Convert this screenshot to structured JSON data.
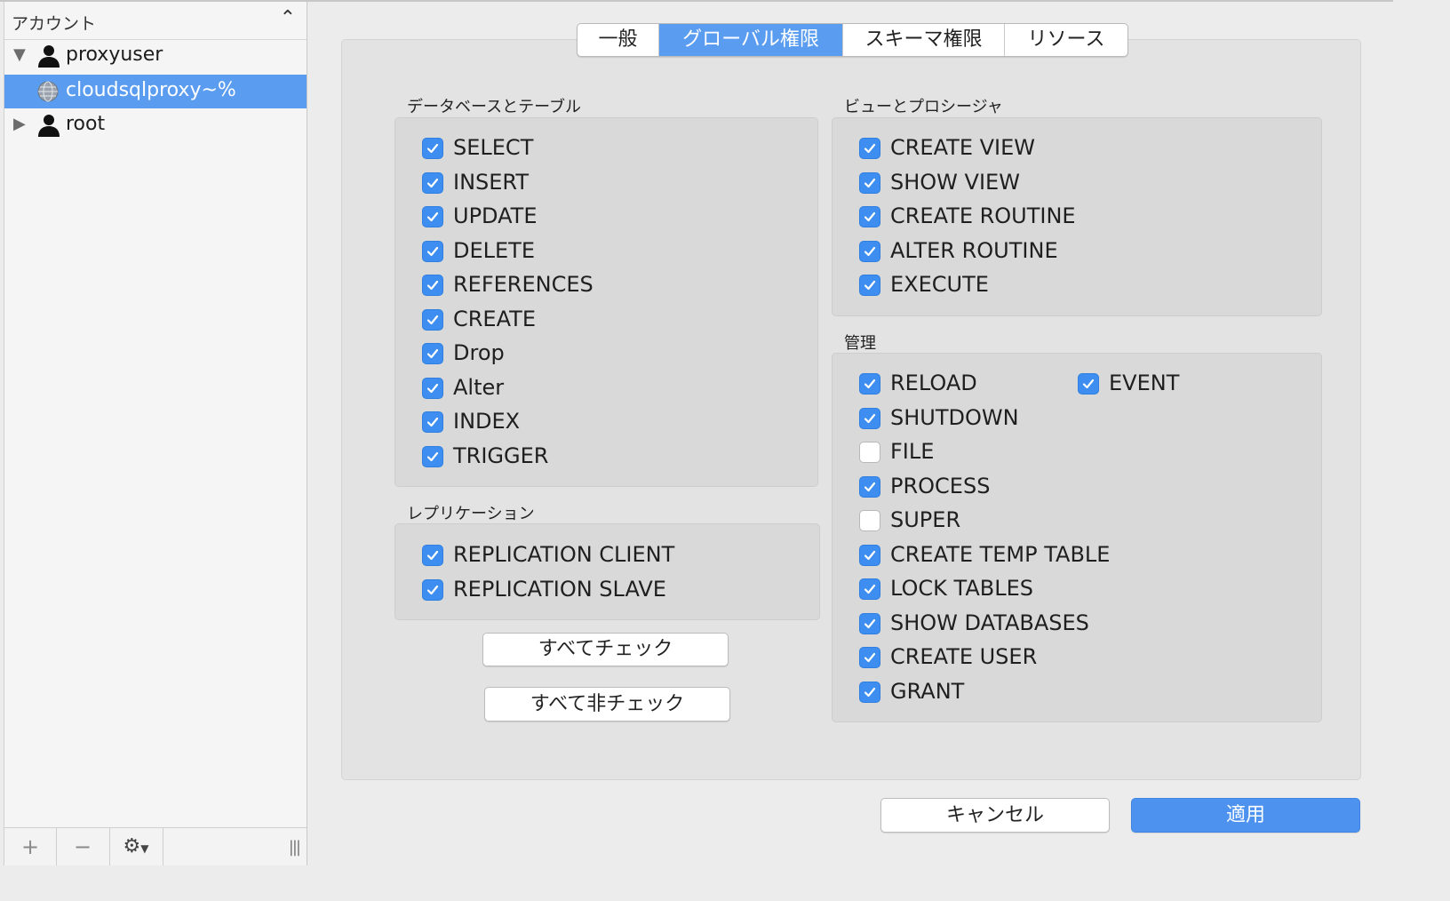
{
  "sidebar": {
    "header": "アカウント",
    "users": [
      {
        "label": "proxyuser",
        "expanded": true
      },
      {
        "label": "cloudsqlproxy~%",
        "selected": true
      },
      {
        "label": "root",
        "expanded": false
      }
    ],
    "footer": {
      "add": "+",
      "remove": "−",
      "grip": "|||"
    }
  },
  "tabs": [
    "一般",
    "グローバル権限",
    "スキーマ権限",
    "リソース"
  ],
  "active_tab": "グローバル権限",
  "groups": {
    "db_tables": {
      "title": "データベースとテーブル",
      "items": [
        {
          "label": "SELECT",
          "checked": true
        },
        {
          "label": "INSERT",
          "checked": true
        },
        {
          "label": "UPDATE",
          "checked": true
        },
        {
          "label": "DELETE",
          "checked": true
        },
        {
          "label": "REFERENCES",
          "checked": true
        },
        {
          "label": "CREATE",
          "checked": true
        },
        {
          "label": "Drop",
          "checked": true
        },
        {
          "label": "Alter",
          "checked": true
        },
        {
          "label": "INDEX",
          "checked": true
        },
        {
          "label": "TRIGGER",
          "checked": true
        }
      ]
    },
    "replication": {
      "title": "レプリケーション",
      "items": [
        {
          "label": "REPLICATION CLIENT",
          "checked": true
        },
        {
          "label": "REPLICATION SLAVE",
          "checked": true
        }
      ]
    },
    "views": {
      "title": "ビューとプロシージャ",
      "items": [
        {
          "label": "CREATE VIEW",
          "checked": true
        },
        {
          "label": "SHOW VIEW",
          "checked": true
        },
        {
          "label": "CREATE ROUTINE",
          "checked": true
        },
        {
          "label": "ALTER ROUTINE",
          "checked": true
        },
        {
          "label": "EXECUTE",
          "checked": true
        }
      ]
    },
    "admin": {
      "title": "管理",
      "items": [
        {
          "label": "RELOAD",
          "checked": true
        },
        {
          "label": "SHUTDOWN",
          "checked": true
        },
        {
          "label": "FILE",
          "checked": false
        },
        {
          "label": "PROCESS",
          "checked": true
        },
        {
          "label": "SUPER",
          "checked": false
        },
        {
          "label": "CREATE TEMP TABLE",
          "checked": true
        },
        {
          "label": "LOCK TABLES",
          "checked": true
        },
        {
          "label": "SHOW DATABASES",
          "checked": true
        },
        {
          "label": "CREATE USER",
          "checked": true
        },
        {
          "label": "GRANT",
          "checked": true
        }
      ],
      "extra": {
        "label": "EVENT",
        "checked": true
      }
    }
  },
  "buttons": {
    "check_all": "すべてチェック",
    "uncheck_all": "すべて非チェック",
    "cancel": "キャンセル",
    "apply": "適用"
  },
  "colors": {
    "accent": "#5a9cf0",
    "checkbox": "#3d8ef0",
    "panel": "#e3e3e3"
  }
}
